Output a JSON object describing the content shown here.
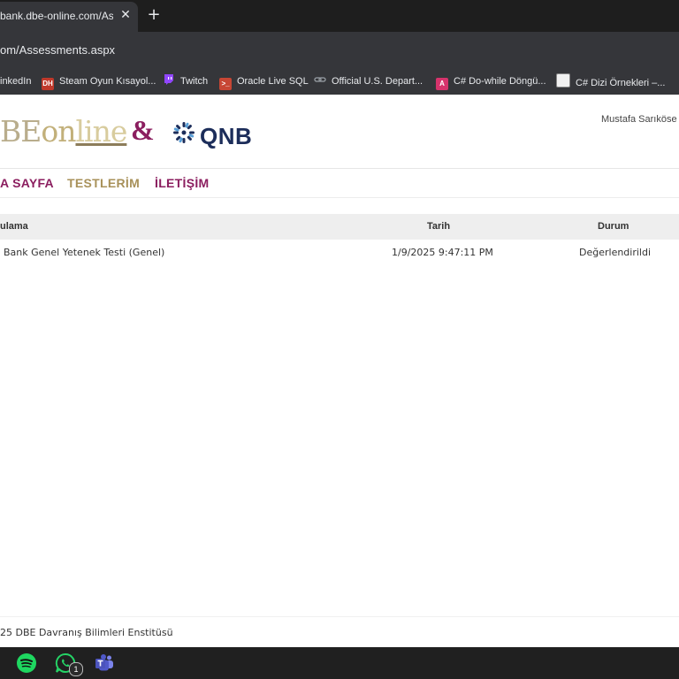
{
  "browser": {
    "tab_title": "bank.dbe-online.com/Assessments.aspx",
    "tab_close": "✕",
    "new_tab": "+",
    "url": "om/Assessments.aspx",
    "bookmarks": [
      {
        "label": "inkedIn"
      },
      {
        "label": "Steam Oyun Kısayol...",
        "icon_text": "DH"
      },
      {
        "label": "Twitch"
      },
      {
        "label": "Oracle Live SQL",
        "icon_text": ">_"
      },
      {
        "label": "Official U.S. Depart..."
      },
      {
        "label": "C# Do-while Döngü...",
        "icon_text": "A"
      },
      {
        "label": "C# Dizi Örnekleri –..."
      }
    ]
  },
  "header": {
    "logo": {
      "part1": "BE",
      "part2": "on",
      "part3": "line"
    },
    "amp": "&",
    "partner": "QNB",
    "user_name": "Mustafa Sarıköse"
  },
  "nav": {
    "items": [
      {
        "label": "A SAYFA",
        "color": "#8b1e5f"
      },
      {
        "label": "TESTLERİM",
        "color": "#a8915a"
      },
      {
        "label": "İLETİŞİM",
        "color": "#8b1e5f"
      }
    ]
  },
  "table": {
    "headers": {
      "application": "ulama",
      "date": "Tarih",
      "status": "Durum"
    },
    "rows": [
      {
        "application": "Bank Genel Yetenek Testi (Genel)",
        "date": "1/9/2025 9:47:11 PM",
        "status": "Değerlendirildi"
      }
    ]
  },
  "footer": {
    "text": "25 DBE Davranış Bilimleri Enstitüsü"
  },
  "taskbar": {
    "whatsapp_badge": "1"
  },
  "colors": {
    "brand_primary": "#8b1e5f",
    "brand_gold": "#a8915a",
    "qnb_navy": "#1c2d5a"
  }
}
